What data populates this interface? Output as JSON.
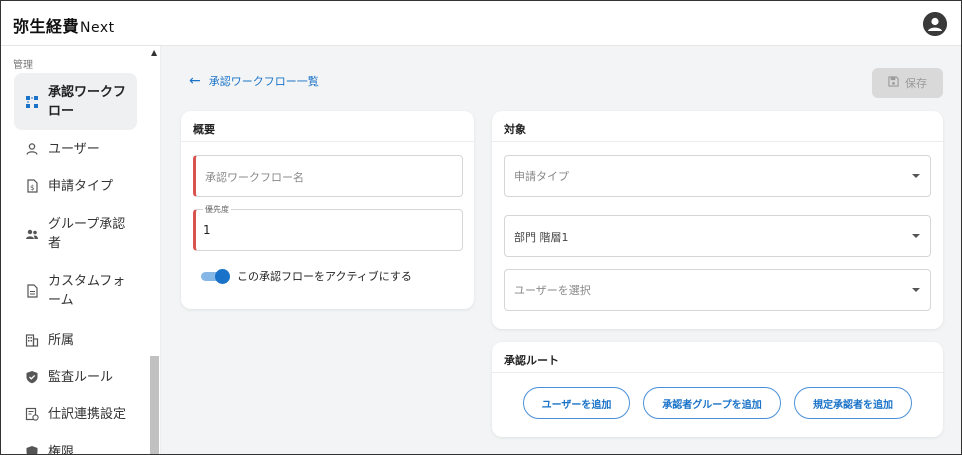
{
  "app": {
    "brand": "弥生経費",
    "brand_suffix": "Next"
  },
  "sidebar": {
    "section_label": "管理",
    "items": [
      {
        "label_line1": "承認ワークフ",
        "label_line2": "ロー",
        "icon": "workflow-icon",
        "active": true
      },
      {
        "label_line1": "ユーザー",
        "icon": "user-icon"
      },
      {
        "label_line1": "申請タイプ",
        "icon": "request-type-icon"
      },
      {
        "label_line1": "グループ承認",
        "label_line2": "者",
        "icon": "group-icon"
      },
      {
        "label_line1": "カスタムフォ",
        "label_line2": "ーム",
        "icon": "form-icon"
      },
      {
        "label_line1": "所属",
        "icon": "building-icon"
      },
      {
        "label_line1": "監査ルール",
        "icon": "shield-icon"
      },
      {
        "label_line1": "仕訳連携設定",
        "icon": "journal-link-icon"
      },
      {
        "label_line1": "権限",
        "icon": "permission-icon"
      }
    ]
  },
  "main": {
    "back_link": "承認ワークフロー一覧",
    "save_label": "保存",
    "overview": {
      "title": "概要",
      "name_placeholder": "承認ワークフロー名",
      "priority_label": "優先度",
      "priority_value": "1",
      "toggle_label": "この承認フローをアクティブにする"
    },
    "target": {
      "title": "対象",
      "request_type_placeholder": "申請タイプ",
      "department_value": "部門 階層1",
      "user_select_placeholder": "ユーザーを選択"
    },
    "route": {
      "title": "承認ルート",
      "add_user": "ユーザーを追加",
      "add_group": "承認者グループを追加",
      "add_fixed": "規定承認者を追加"
    }
  },
  "colors": {
    "accent": "#1a73c8",
    "required": "#d9534f",
    "background": "#f3f4f5"
  }
}
